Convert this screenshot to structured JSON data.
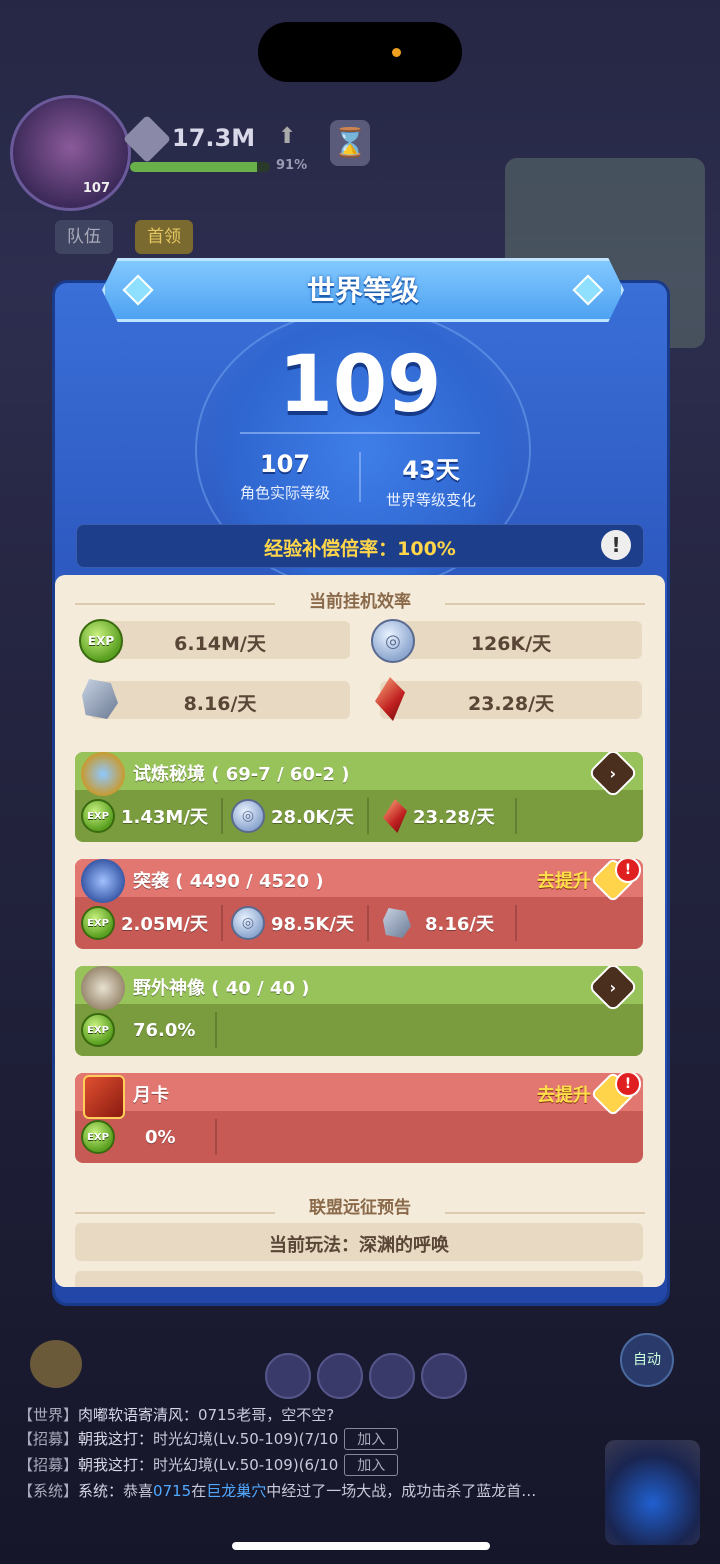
{
  "hud": {
    "player_level": "107",
    "power": "17.3M",
    "progress_percent": "91%",
    "progress_value": 0.91,
    "tabs": [
      "队伍",
      "首领"
    ]
  },
  "panel": {
    "title": "世界等级",
    "world_level": "109",
    "actual_level_value": "107",
    "actual_level_label": "角色实际等级",
    "level_change_value": "43天",
    "level_change_label": "世界等级变化",
    "exp_rate": "经验补偿倍率：100%"
  },
  "idle": {
    "title": "当前挂机效率",
    "exp": "6.14M/天",
    "coin": "126K/天",
    "stone": "8.16/天",
    "crystal": "23.28/天"
  },
  "cards": [
    {
      "name": "试炼秘境 ( 69-7 / 60-2 )",
      "color": "green",
      "v1": "1.43M/天",
      "v2": "28.0K/天",
      "v3": "23.28/天"
    },
    {
      "name": "突袭 ( 4490 / 4520 )",
      "color": "red",
      "improve": "去提升",
      "v1": "2.05M/天",
      "v2": "98.5K/天",
      "v3": "8.16/天"
    },
    {
      "name": "野外神像 ( 40 / 40 )",
      "color": "green",
      "v1": "76.0%"
    },
    {
      "name": "月卡",
      "color": "red",
      "improve": "去提升",
      "v1": "0%"
    }
  ],
  "alliance": {
    "title": "联盟远征预告",
    "current": "当前玩法：深渊的呼唤"
  },
  "chat": [
    {
      "channel": "【世界】",
      "name": "肉嘟软语寄清风：",
      "text": "0715老哥，空不空?"
    },
    {
      "channel": "【招募】",
      "name": "朝我这打：",
      "text": "时光幻境(Lv.50-109)(7/10",
      "join": "加入"
    },
    {
      "channel": "【招募】",
      "name": "朝我这打：",
      "text": "时光幻境(Lv.50-109)(6/10",
      "join": "加入"
    },
    {
      "channel": "【系统】",
      "name": "系统：",
      "text_a": "恭喜",
      "hl1": "0715",
      "text_b": "在",
      "hl2": "巨龙巢穴",
      "text_c": "中经过了一场大战，成功击杀了蓝龙首…"
    }
  ],
  "auto_label": "自动",
  "colors": {
    "panel_blue": "#2c58bf",
    "exp_gold": "#ffd64a",
    "card_green": "#98c25a",
    "card_red": "#e27670"
  }
}
